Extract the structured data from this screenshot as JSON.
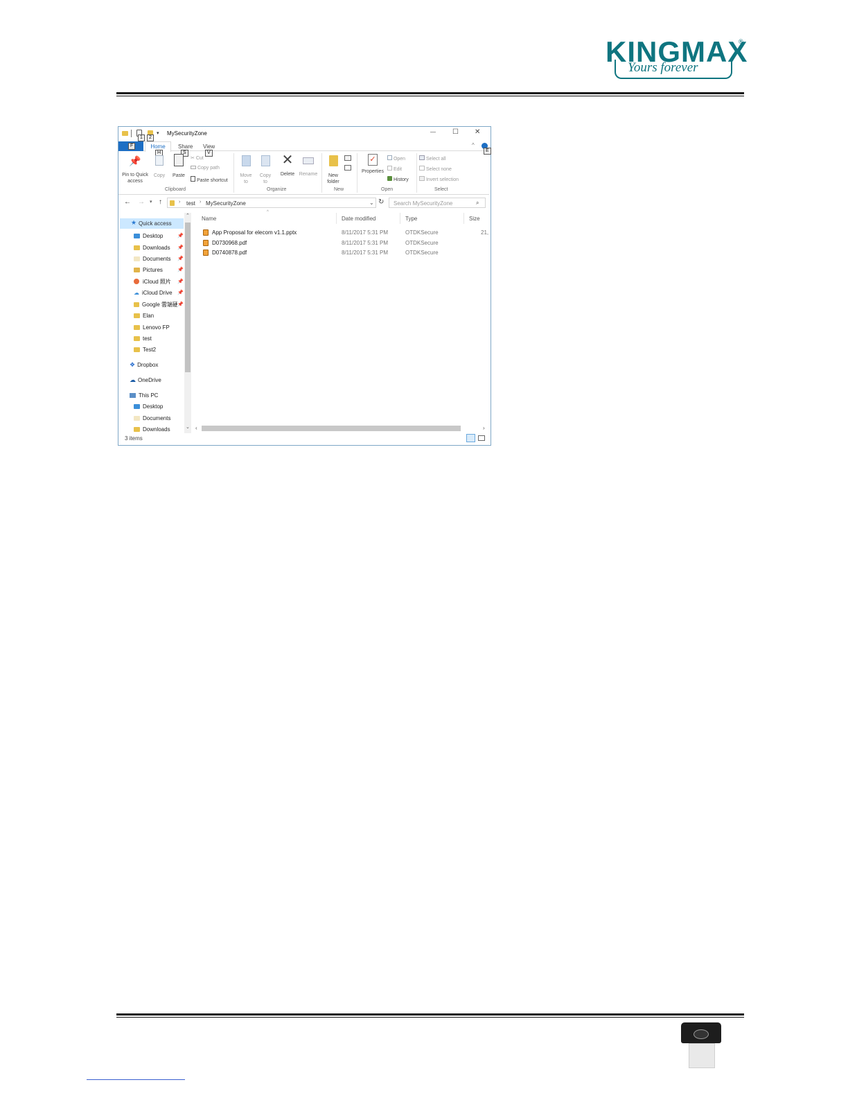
{
  "header": {
    "logo_text": "KINGMAX",
    "logo_registered": "®",
    "logo_tagline": "Yours forever"
  },
  "window": {
    "title": "MySecurityZone",
    "quick_toolbar_keytips": [
      "1",
      "2"
    ],
    "file_tab": "F",
    "tabs": [
      {
        "label": "Home",
        "keytip": "H"
      },
      {
        "label": "Share",
        "keytip": "S"
      },
      {
        "label": "View",
        "keytip": "V"
      }
    ],
    "help_keytip": "E",
    "controls": {
      "minimize": "—",
      "maximize": "☐",
      "close": "✕"
    },
    "ribbon": {
      "clipboard": {
        "pin_label": "Pin to Quick access",
        "copy_label": "Copy",
        "paste_label": "Paste",
        "cut_label": "Cut",
        "copy_path_label": "Copy path",
        "paste_shortcut_label": "Paste shortcut",
        "group_label": "Clipboard"
      },
      "organize": {
        "move_to_label": "Move to",
        "copy_to_label": "Copy to",
        "delete_label": "Delete",
        "rename_label": "Rename",
        "group_label": "Organize"
      },
      "new": {
        "new_folder_label": "New folder",
        "group_label": "New"
      },
      "open": {
        "properties_label": "Properties",
        "open_label": "Open",
        "edit_label": "Edit",
        "history_label": "History",
        "group_label": "Open"
      },
      "select": {
        "select_all_label": "Select all",
        "select_none_label": "Select none",
        "invert_label": "Invert selection",
        "group_label": "Select"
      }
    },
    "address": {
      "crumbs": [
        "test",
        "MySecurityZone"
      ],
      "search_placeholder": "Search MySecurityZone"
    },
    "nav_pane": {
      "quick_access": "Quick access",
      "pinned": [
        {
          "label": "Desktop"
        },
        {
          "label": "Downloads"
        },
        {
          "label": "Documents"
        },
        {
          "label": "Pictures"
        },
        {
          "label": "iCloud 照片"
        },
        {
          "label": "iCloud Drive"
        },
        {
          "label": "Google 雲端硬碟"
        }
      ],
      "folders": [
        {
          "label": "Elan"
        },
        {
          "label": "Lenovo FP"
        },
        {
          "label": "test"
        },
        {
          "label": "Test2"
        }
      ],
      "dropbox": "Dropbox",
      "onedrive": "OneDrive",
      "this_pc": "This PC",
      "pc_items": [
        {
          "label": "Desktop"
        },
        {
          "label": "Documents"
        },
        {
          "label": "Downloads"
        }
      ]
    },
    "columns": {
      "name": "Name",
      "date": "Date modified",
      "type": "Type",
      "size": "Size"
    },
    "files": [
      {
        "name": "App Proposal for elecom v1.1.pptx",
        "date": "8/11/2017 5:31 PM",
        "type": "OTDKSecure",
        "size": "21,"
      },
      {
        "name": "D0730968.pdf",
        "date": "8/11/2017 5:31 PM",
        "type": "OTDKSecure",
        "size": ""
      },
      {
        "name": "D0740878.pdf",
        "date": "8/11/2017 5:31 PM",
        "type": "OTDKSecure",
        "size": ""
      }
    ],
    "status": "3 items"
  },
  "colors": {
    "brand": "#0f7580",
    "file_tab": "#1e6fc4",
    "window_border": "#7ea7c7"
  }
}
